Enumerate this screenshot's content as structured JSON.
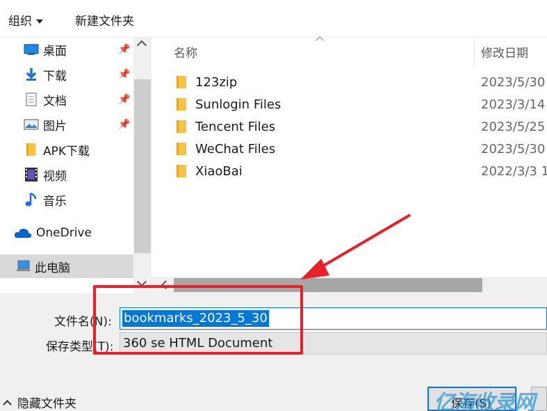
{
  "toolbar": {
    "organize_label": "组织",
    "new_folder_label": "新建文件夹"
  },
  "nav": {
    "items": [
      {
        "label": "桌面",
        "icon": "desktop-icon",
        "pinned": true
      },
      {
        "label": "下载",
        "icon": "download-icon",
        "pinned": true
      },
      {
        "label": "文档",
        "icon": "document-icon",
        "pinned": true
      },
      {
        "label": "图片",
        "icon": "picture-icon",
        "pinned": true
      },
      {
        "label": "APK下载",
        "icon": "folder-icon",
        "pinned": false
      },
      {
        "label": "视频",
        "icon": "video-icon",
        "pinned": false
      },
      {
        "label": "音乐",
        "icon": "music-icon",
        "pinned": false
      },
      {
        "label": "OneDrive",
        "icon": "cloud-icon",
        "pinned": false
      },
      {
        "label": "此电脑",
        "icon": "computer-icon",
        "pinned": false
      }
    ]
  },
  "file_list": {
    "column_name": "名称",
    "column_date": "修改日期",
    "rows": [
      {
        "name": "123zip",
        "date": "2023/5/30"
      },
      {
        "name": "Sunlogin Files",
        "date": "2023/3/14"
      },
      {
        "name": "Tencent Files",
        "date": "2023/5/25"
      },
      {
        "name": "WeChat Files",
        "date": "2023/5/30"
      },
      {
        "name": "XiaoBai",
        "date": "2022/3/3 1"
      }
    ]
  },
  "save_form": {
    "filename_label": "文件名(N):",
    "filename_value": "bookmarks_2023_5_30",
    "filetype_label": "保存类型(T):",
    "filetype_value": "360 se HTML Document",
    "hide_folders_label": "隐藏文件夹",
    "save_button_label": "保存(S)"
  },
  "watermark": "亿海收录网",
  "colors": {
    "accent": "#0078d7",
    "annotation": "#e8202a",
    "folder": "#f6c342"
  }
}
